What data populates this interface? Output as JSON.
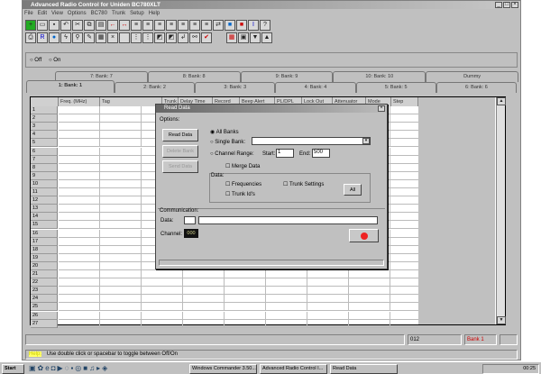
{
  "window": {
    "title": "Advanced Radio Control for Uniden BC780XLT"
  },
  "menu": [
    "File",
    "Edit",
    "View",
    "Options",
    "BC780",
    "Trunk",
    "Setup",
    "Help"
  ],
  "toggle": {
    "off": "Off",
    "on": "On",
    "selected": "Off"
  },
  "tabs_row1": [
    "7: Bank: 7",
    "8: Bank: 8",
    "9: Bank: 9",
    "10: Bank: 10",
    "Dummy"
  ],
  "tabs_row2": [
    "1: Bank: 1",
    "2: Bank: 2",
    "3: Bank: 3",
    "4: Bank: 4",
    "5: Bank: 5",
    "6: Bank: 6"
  ],
  "active_tab": "1: Bank: 1",
  "grid": {
    "columns": [
      "Freq. (MHz)",
      "Tag",
      "Trunk",
      "Delay Time",
      "Record",
      "Beep Alert",
      "PL/DPL",
      "Lock Out",
      "Attenuator",
      "Mode",
      "Step"
    ],
    "row_count": 27
  },
  "dialog": {
    "title": "Read Data",
    "options_label": "Options:",
    "read_data": "Read Data",
    "delete_bank": "Delete Bank",
    "send_data": "Send Data",
    "all_banks": "All Banks",
    "single_bank": "Single Bank:",
    "channel_range": "Channel Range:",
    "start_label": "Start:",
    "start_value": "1",
    "end_label": "End:",
    "end_value": "500",
    "merge_data": "Merge Data",
    "data_label": "Data:",
    "frequencies": "Frequencies",
    "trunk_settings": "Trunk Settings",
    "trunk_ids": "Trunk Id's",
    "all_button": "All",
    "communication_label": "Communication:",
    "data_field_label": "Data:",
    "channel_label": "Channel:",
    "channel_value": "000"
  },
  "status": {
    "channel": "012",
    "bank": "Bank 1",
    "bank_color": "#cc0000",
    "hint_prefix": "Help:",
    "hint": "Use double click or spacebar to toggle between Off/On"
  },
  "taskbar": {
    "start": "Start",
    "tasks": [
      "Windows Commander 3.50...",
      "Advanced Radio Control I...",
      "Read Data"
    ],
    "clock": "00:25"
  }
}
